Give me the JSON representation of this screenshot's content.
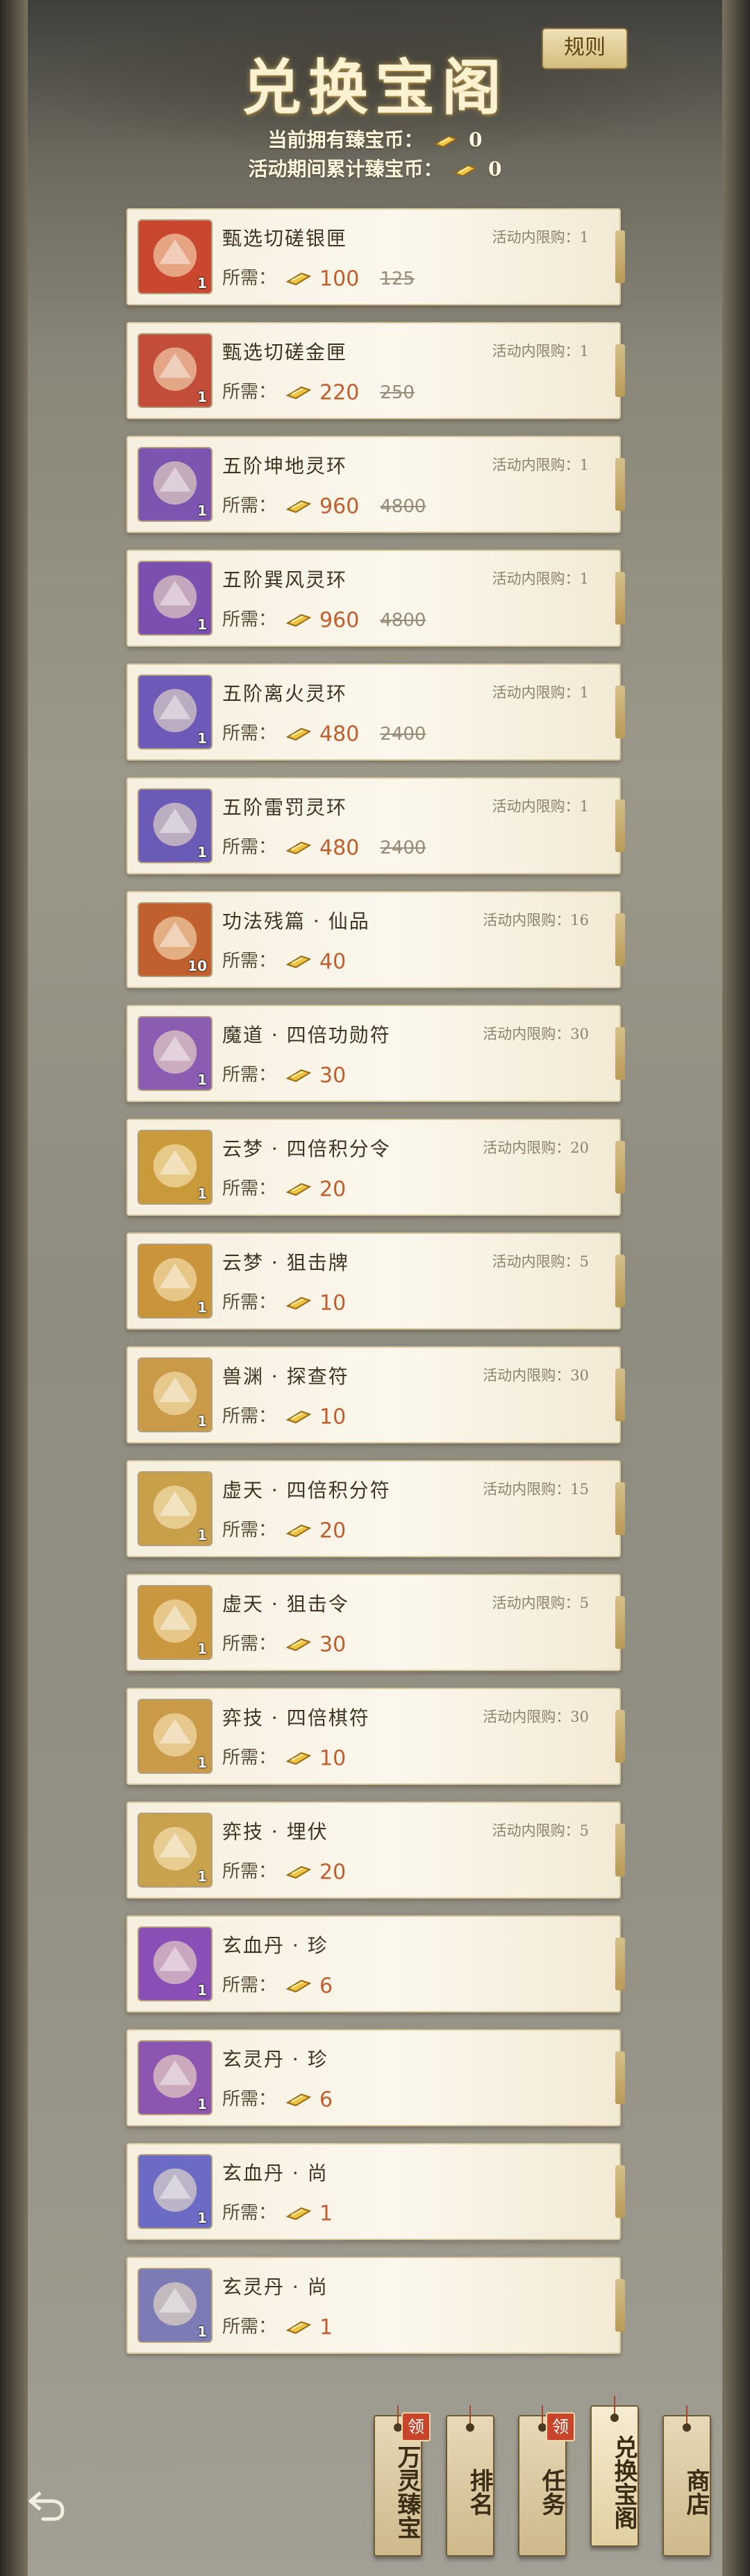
{
  "header": {
    "title": "兑换宝阁",
    "rules_label": "规则",
    "owned_label": "当前拥有臻宝币：",
    "owned_value": "0",
    "accum_label": "活动期间累计臻宝币：",
    "accum_value": "0"
  },
  "labels": {
    "need": "所需：",
    "limit_prefix": "活动内限购："
  },
  "items": [
    {
      "name": "甄选切磋银匣",
      "qty": "1",
      "price": "100",
      "orig": "125",
      "limit": "1",
      "icon": "silver-chest-icon",
      "color": "#c8472e"
    },
    {
      "name": "甄选切磋金匣",
      "qty": "1",
      "price": "220",
      "orig": "250",
      "limit": "1",
      "icon": "gold-chest-icon",
      "color": "#c24e3a"
    },
    {
      "name": "五阶坤地灵环",
      "qty": "1",
      "price": "960",
      "orig": "4800",
      "limit": "1",
      "icon": "earth-ring-icon",
      "color": "#7b55b0"
    },
    {
      "name": "五阶巽风灵环",
      "qty": "1",
      "price": "960",
      "orig": "4800",
      "limit": "1",
      "icon": "wind-ring-icon",
      "color": "#7a4fb0"
    },
    {
      "name": "五阶离火灵环",
      "qty": "1",
      "price": "480",
      "orig": "2400",
      "limit": "1",
      "icon": "fire-ring-icon",
      "color": "#6c59b8"
    },
    {
      "name": "五阶雷罚灵环",
      "qty": "1",
      "price": "480",
      "orig": "2400",
      "limit": "1",
      "icon": "thunder-ring-icon",
      "color": "#6a5bb6"
    },
    {
      "name": "功法残篇 · 仙品",
      "qty": "10",
      "price": "40",
      "orig": "",
      "limit": "16",
      "icon": "scroll-book-icon",
      "color": "#c0602e"
    },
    {
      "name": "魔道 · 四倍功勋符",
      "qty": "1",
      "price": "30",
      "orig": "",
      "limit": "30",
      "icon": "talisman-icon",
      "color": "#8a5cb2"
    },
    {
      "name": "云梦 · 四倍积分令",
      "qty": "1",
      "price": "20",
      "orig": "",
      "limit": "20",
      "icon": "fan-token-icon",
      "color": "#c99a3a"
    },
    {
      "name": "云梦 · 狙击牌",
      "qty": "1",
      "price": "10",
      "orig": "",
      "limit": "5",
      "icon": "snipe-plate-icon",
      "color": "#c9943a"
    },
    {
      "name": "兽渊 · 探查符",
      "qty": "1",
      "price": "10",
      "orig": "",
      "limit": "30",
      "icon": "probe-talisman-icon",
      "color": "#c99a48"
    },
    {
      "name": "虚天 · 四倍积分符",
      "qty": "1",
      "price": "20",
      "orig": "",
      "limit": "15",
      "icon": "bag-talisman-icon",
      "color": "#c9a04a"
    },
    {
      "name": "虚天 · 狙击令",
      "qty": "1",
      "price": "30",
      "orig": "",
      "limit": "5",
      "icon": "snipe-order-icon",
      "color": "#c9973e"
    },
    {
      "name": "弈技 · 四倍棋符",
      "qty": "1",
      "price": "10",
      "orig": "",
      "limit": "30",
      "icon": "chess-talisman-icon",
      "color": "#c99a48"
    },
    {
      "name": "弈技 · 埋伏",
      "qty": "1",
      "price": "20",
      "orig": "",
      "limit": "5",
      "icon": "ambush-crystal-icon",
      "color": "#c9a24e"
    },
    {
      "name": "玄血丹 · 珍",
      "qty": "1",
      "price": "6",
      "orig": "",
      "limit": "",
      "icon": "xuanxue-pill-box-icon",
      "color": "#8a4fb6"
    },
    {
      "name": "玄灵丹 · 珍",
      "qty": "1",
      "price": "6",
      "orig": "",
      "limit": "",
      "icon": "xuanling-pill-box-icon",
      "color": "#8c55b0"
    },
    {
      "name": "玄血丹 · 尚",
      "qty": "1",
      "price": "1",
      "orig": "",
      "limit": "",
      "icon": "xuanxue-orb-icon",
      "color": "#6b6bc6"
    },
    {
      "name": "玄灵丹 · 尚",
      "qty": "1",
      "price": "1",
      "orig": "",
      "limit": "",
      "icon": "xuanling-orb-icon",
      "color": "#7c7bb6"
    }
  ],
  "nav": [
    {
      "label": "万灵臻宝",
      "badge": "领"
    },
    {
      "label": "排名",
      "badge": ""
    },
    {
      "label": "任务",
      "badge": "领"
    },
    {
      "label": "兑换宝阁",
      "badge": ""
    },
    {
      "label": "商店",
      "badge": ""
    }
  ]
}
